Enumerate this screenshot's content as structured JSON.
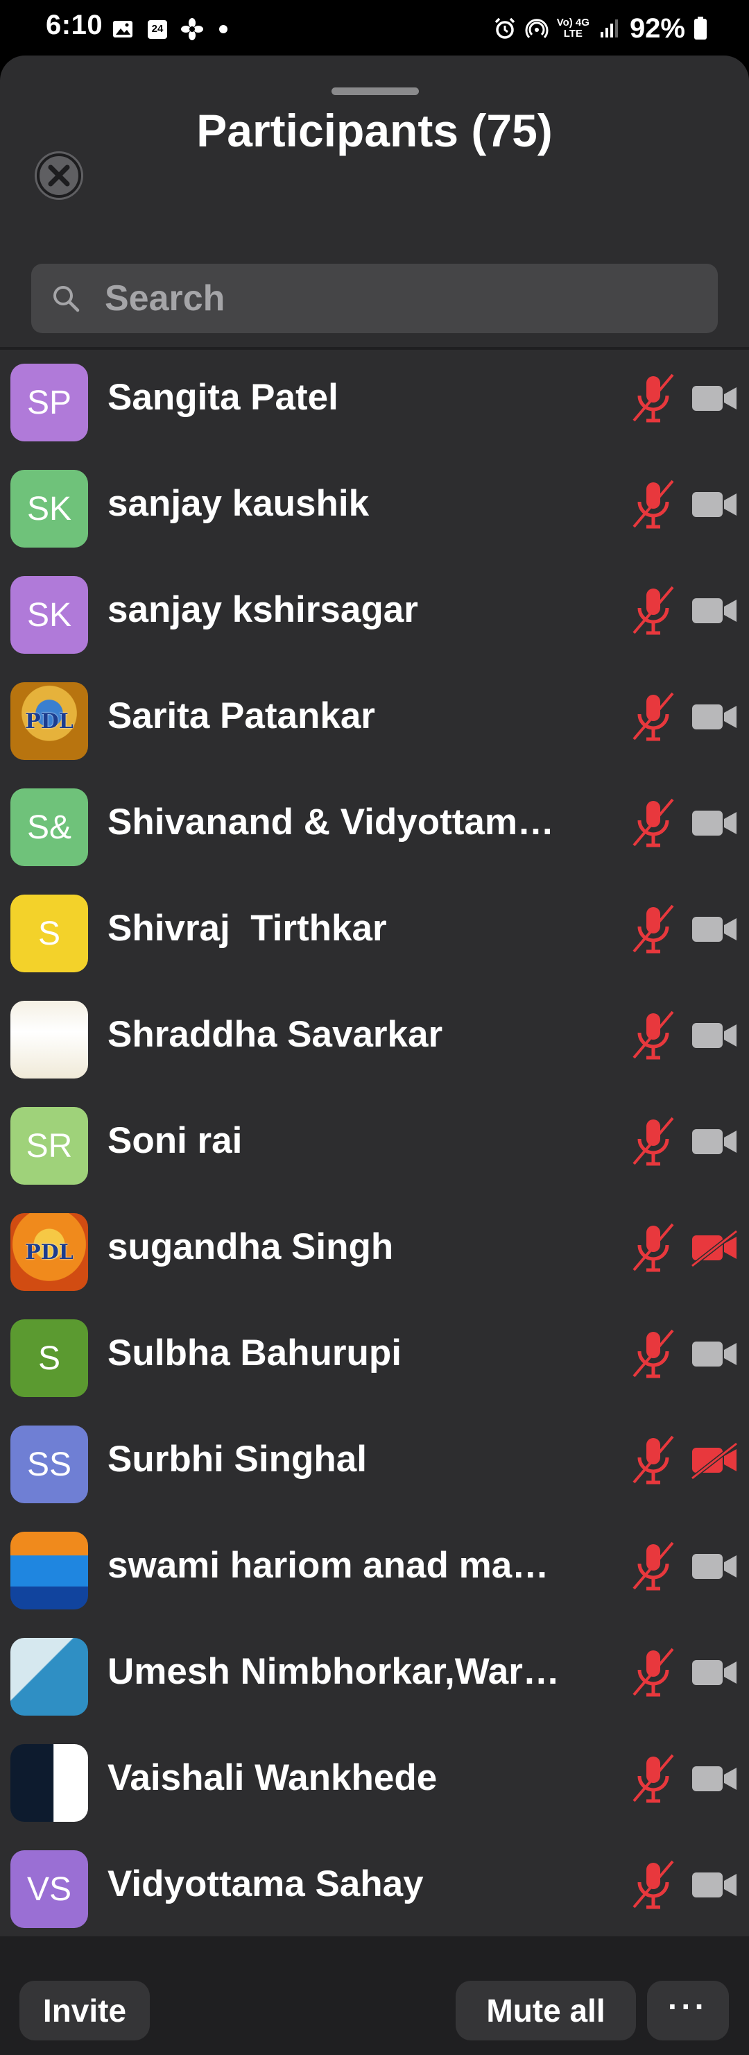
{
  "status_bar": {
    "time": "6:10",
    "battery": "92%",
    "network_top": "Vo) 4G",
    "network_bottom": "LTE",
    "left_icons": [
      "image-icon",
      "calendar-24-icon",
      "pinwheel-icon",
      "dot-icon"
    ],
    "right_icons": [
      "alarm-icon",
      "hotspot-icon",
      "signal-icon",
      "battery-icon"
    ],
    "calendar_day": "24"
  },
  "sheet": {
    "title": "Participants (75)",
    "close_icon": "close-icon",
    "search": {
      "placeholder": "Search",
      "value": ""
    }
  },
  "participants": [
    {
      "initials": "SP",
      "name": "Sangita Patel",
      "avatar_color": "#b07ad9",
      "mic": "muted",
      "video": "off"
    },
    {
      "initials": "SK",
      "name": "sanjay kaushik",
      "avatar_color": "#6fc27a",
      "mic": "muted",
      "video": "off"
    },
    {
      "initials": "SK",
      "name": "sanjay kshirsagar",
      "avatar_color": "#b07ad9",
      "mic": "muted",
      "video": "off"
    },
    {
      "initials": "PDL",
      "name": "Sarita Patankar",
      "avatar_color": "",
      "mic": "muted",
      "video": "off"
    },
    {
      "initials": "S&",
      "name": "Shivanand & Vidyottam…",
      "avatar_color": "#6fc27a",
      "mic": "muted",
      "video": "off"
    },
    {
      "initials": "S",
      "name": "Shivraj  Tirthkar",
      "avatar_color": "#f3d22a",
      "mic": "muted",
      "video": "off"
    },
    {
      "initials": "",
      "name": "Shraddha Savarkar",
      "avatar_color": "",
      "mic": "muted",
      "video": "off"
    },
    {
      "initials": "SR",
      "name": "Soni rai",
      "avatar_color": "#9fd27a",
      "mic": "muted",
      "video": "off"
    },
    {
      "initials": "PDL",
      "name": "sugandha Singh",
      "avatar_color": "",
      "mic": "muted",
      "video": "blocked"
    },
    {
      "initials": "S",
      "name": "Sulbha Bahurupi",
      "avatar_color": "#5b9a30",
      "mic": "muted",
      "video": "off"
    },
    {
      "initials": "SS",
      "name": "Surbhi Singhal",
      "avatar_color": "#6f7fd4",
      "mic": "muted",
      "video": "blocked"
    },
    {
      "initials": "",
      "name": "swami hariom anad mah…",
      "avatar_color": "",
      "mic": "muted",
      "video": "off"
    },
    {
      "initials": "",
      "name": "Umesh Nimbhorkar,War…",
      "avatar_color": "",
      "mic": "muted",
      "video": "off"
    },
    {
      "initials": "",
      "name": "Vaishali Wankhede",
      "avatar_color": "",
      "mic": "muted",
      "video": "off"
    },
    {
      "initials": "VS",
      "name": "Vidyottama Sahay",
      "avatar_color": "#9a6fd4",
      "mic": "muted",
      "video": "off"
    }
  ],
  "bottom_bar": {
    "invite_label": "Invite",
    "mute_all_label": "Mute all",
    "more_label": "···"
  },
  "colors": {
    "sheet_bg": "#2d2d2f",
    "muted_red": "#e8383d",
    "icon_gray": "#b8b8ba"
  }
}
